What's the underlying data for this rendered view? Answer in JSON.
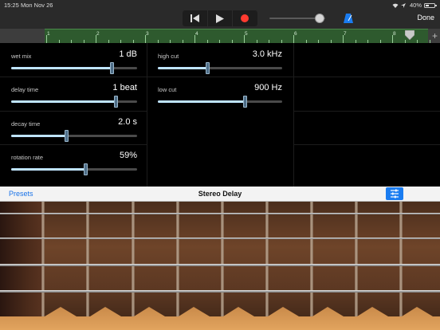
{
  "status": {
    "time": "15:25",
    "date": "Mon Nov 26",
    "battery": "40%",
    "battery_level": 0.4
  },
  "control": {
    "done_label": "Done",
    "volume_level": 0.9
  },
  "ruler": {
    "bars": [
      "1",
      "2",
      "3",
      "4",
      "5",
      "6",
      "7",
      "8"
    ],
    "plus_label": "+"
  },
  "params": [
    {
      "label": "wet mix",
      "value": "1 dB",
      "level": 0.8
    },
    {
      "label": "delay time",
      "value": "1 beat",
      "level": 0.83
    },
    {
      "label": "decay time",
      "value": "2.0 s",
      "level": 0.44
    },
    {
      "label": "rotation rate",
      "value": "59%",
      "level": 0.59
    },
    {
      "label": "high cut",
      "value": "3.0 kHz",
      "level": 0.4
    },
    {
      "label": "low cut",
      "value": "900 Hz",
      "level": 0.7
    }
  ],
  "preset_bar": {
    "presets_label": "Presets",
    "preset_name": "Stereo Delay"
  },
  "colors": {
    "accent": "#1a7cf0",
    "record": "#ff3b30",
    "slider_fill": "#bfe4ff"
  }
}
